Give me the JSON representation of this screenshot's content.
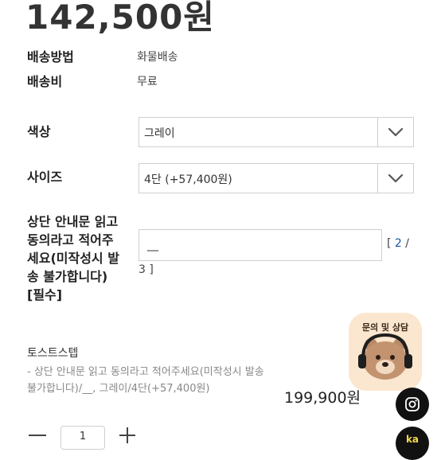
{
  "product": {
    "price": "142,500원"
  },
  "shipping": {
    "method_label": "배송방법",
    "method_value": "화물배송",
    "fee_label": "배송비",
    "fee_value": "무료"
  },
  "options": {
    "color_label": "색상",
    "color_selected": "그레이",
    "size_label": "사이즈",
    "size_selected": "4단 (+57,400원)"
  },
  "custom_text": {
    "label_line1": "상단 안내문 읽고",
    "label_line2": "동의라고 적어주",
    "label_line3": "세요(미작성시 발",
    "label_line4": "송 불가합니다)",
    "label_line5": "[필수]",
    "value": "__",
    "counter_open": "[",
    "counter_current": "2",
    "counter_sep": "/",
    "counter_max": "3",
    "counter_close": "]"
  },
  "selected_item": {
    "name": "토스트스텝",
    "options_text": "- 상단 안내문 읽고 동의라고 적어주세요(미작성시 발송 불가합니다)/__, 그레이/4단(+57,400원)",
    "price": "199,900원",
    "quantity": "1"
  },
  "floating": {
    "chat_title": "문의 및 상담",
    "kakao_text": "ka"
  }
}
